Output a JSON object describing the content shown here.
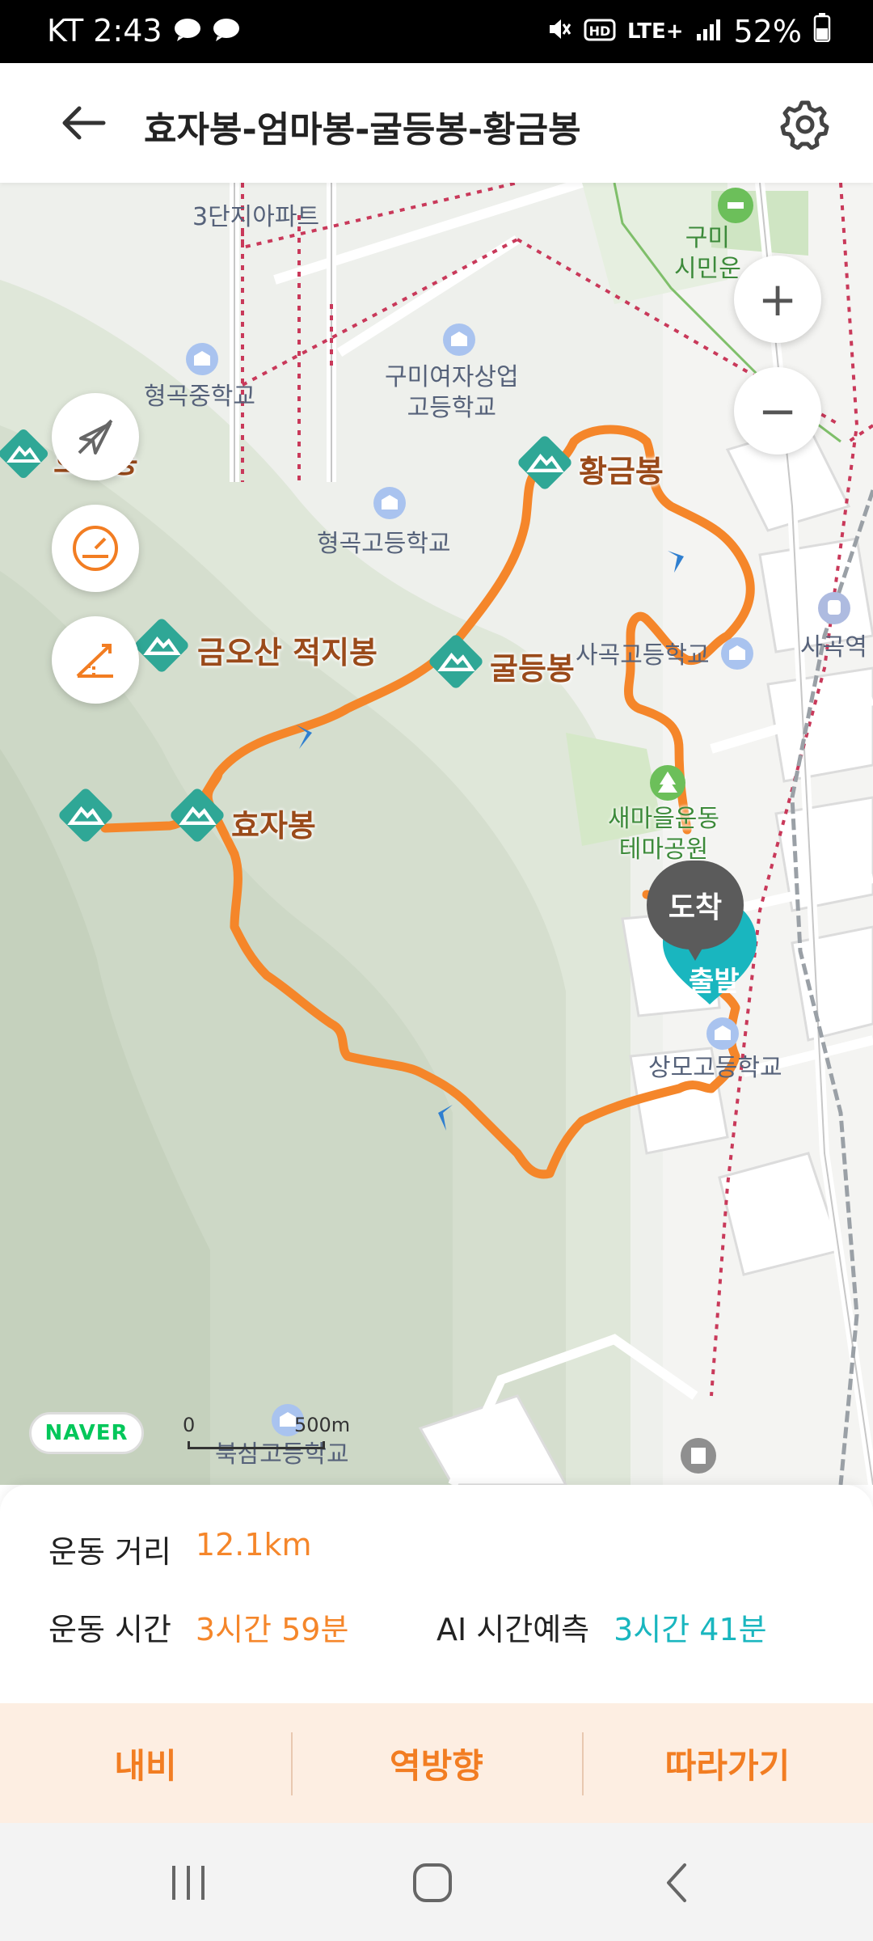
{
  "status_bar": {
    "carrier_time": "KT 2:43",
    "network": "LTE+",
    "battery": "52%",
    "icons": [
      "messenger-icon",
      "messenger-icon",
      "mute-icon",
      "hd-voice-icon",
      "signal-icon",
      "battery-icon"
    ]
  },
  "header": {
    "title": "효자봉-엄마봉-굴등봉-황금봉",
    "back_icon": "back-arrow-icon",
    "settings_icon": "gear-icon"
  },
  "map": {
    "place_labels": {
      "apartment": "3단지아파트",
      "citizen_park": "구미\n시민운",
      "hyeonggok_middle": "형곡중학교",
      "gumi_girls": "구미여자상업\n고등학교",
      "hyeonggok_high": "형곡고등학교",
      "sagok_high": "사곡고등학교",
      "sagok_station": "사곡역",
      "saemaeul_park": "새마을운동\n테마공원",
      "sangmo_high": "상모고등학교",
      "buksam_high": "북삼고등학교"
    },
    "peaks": {
      "hodeung": "호덩봉",
      "hwanggeum": "황금봉",
      "geumosan": "금오산 적지봉",
      "guldeung": "굴등봉",
      "hyoja": "효자봉"
    },
    "arrival_marker": "도착",
    "start_marker": "출발",
    "zoom_in": "+",
    "zoom_out": "−",
    "map_provider": "NAVER",
    "scale_start": "0",
    "scale_end": "500m",
    "route_color": "#f5862a",
    "accent_teal": "#19b6bf",
    "control_icons": [
      "compass-off-icon",
      "speedometer-icon",
      "elevation-icon"
    ]
  },
  "stats": {
    "distance_label": "운동 거리",
    "distance_value": "12.1km",
    "time_label": "운동 시간",
    "time_value": "3시간 59분",
    "ai_label": "AI 시간예측",
    "ai_value": "3시간 41분"
  },
  "actions": {
    "navi": "내비",
    "reverse": "역방향",
    "follow": "따라가기"
  },
  "nav_bar": {
    "icons": [
      "recent-apps-icon",
      "home-icon",
      "back-icon"
    ]
  }
}
